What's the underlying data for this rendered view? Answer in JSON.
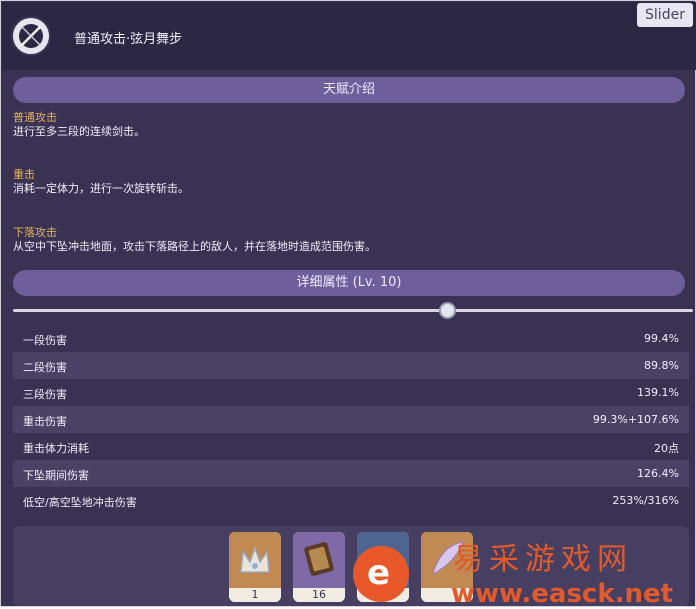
{
  "header": {
    "title": "普通攻击·弦月舞步",
    "slider_tag": "Slider"
  },
  "talent_section": {
    "title": "天赋介绍",
    "items": [
      {
        "heading": "普通攻击",
        "text": "进行至多三段的连续剑击。"
      },
      {
        "heading": "重击",
        "text": "消耗一定体力，进行一次旋转斩击。"
      },
      {
        "heading": "下落攻击",
        "text": "从空中下坠冲击地面，攻击下落路径上的敌人，并在落地时造成范围伤害。"
      }
    ]
  },
  "detail_section": {
    "title": "详细属性 (Lv. 10)",
    "level": 10
  },
  "level_slider": {
    "value_fraction": 0.65
  },
  "stats": [
    {
      "label": "一段伤害",
      "value": "99.4%"
    },
    {
      "label": "二段伤害",
      "value": "89.8%"
    },
    {
      "label": "三段伤害",
      "value": "139.1%"
    },
    {
      "label": "重击伤害",
      "value": "99.3%+107.6%"
    },
    {
      "label": "重击体力消耗",
      "value": "20点"
    },
    {
      "label": "下坠期间伤害",
      "value": "126.4%"
    },
    {
      "label": "低空/高空坠地冲击伤害",
      "value": "253%/316%"
    }
  ],
  "materials": [
    {
      "icon": "crown-icon",
      "count": "1"
    },
    {
      "icon": "book-icon",
      "count": "16"
    },
    {
      "icon": "item-icon",
      "count": ""
    },
    {
      "icon": "feather-icon",
      "count": ""
    }
  ],
  "watermark": {
    "site_name": "易采游戏网",
    "url": "www.easck.net"
  },
  "colors": {
    "panel": "#3a3252",
    "header": "#2c2742",
    "section_bar": "#6e5f9a",
    "heading": "#e7b45a",
    "watermark": "#e15a2b"
  }
}
